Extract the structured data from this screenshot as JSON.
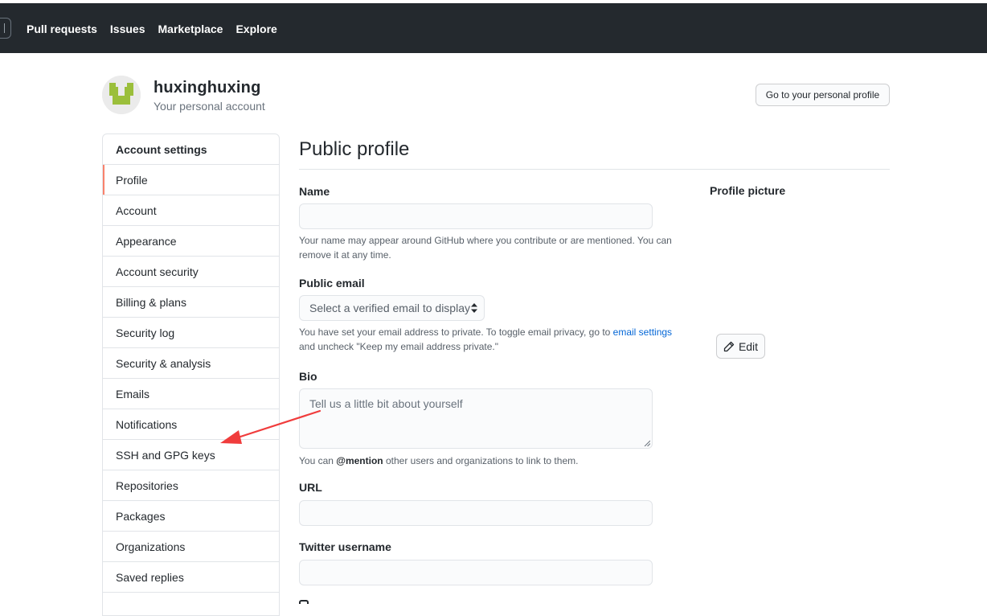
{
  "header": {
    "nav": [
      "Pull requests",
      "Issues",
      "Marketplace",
      "Explore"
    ]
  },
  "account": {
    "username": "huxinghuxing",
    "account_type": "Your personal account",
    "profile_button": "Go to your personal profile"
  },
  "sidebar": {
    "heading": "Account settings",
    "items": [
      {
        "label": "Profile",
        "active": true
      },
      {
        "label": "Account"
      },
      {
        "label": "Appearance"
      },
      {
        "label": "Account security"
      },
      {
        "label": "Billing & plans"
      },
      {
        "label": "Security log"
      },
      {
        "label": "Security & analysis"
      },
      {
        "label": "Emails"
      },
      {
        "label": "Notifications"
      },
      {
        "label": "SSH and GPG keys"
      },
      {
        "label": "Repositories"
      },
      {
        "label": "Packages"
      },
      {
        "label": "Organizations"
      },
      {
        "label": "Saved replies"
      }
    ]
  },
  "main": {
    "title": "Public profile",
    "name": {
      "label": "Name",
      "value": "",
      "note": "Your name may appear around GitHub where you contribute or are mentioned. You can remove it at any time."
    },
    "public_email": {
      "label": "Public email",
      "selected": "Select a verified email to display",
      "note_before": "You have set your email address to private. To toggle email privacy, go to ",
      "note_link": "email settings",
      "note_after": " and uncheck \"Keep my email address private.\""
    },
    "bio": {
      "label": "Bio",
      "placeholder": "Tell us a little bit about yourself",
      "note_before": "You can ",
      "note_mention": "@mention",
      "note_after": " other users and organizations to link to them."
    },
    "url": {
      "label": "URL",
      "value": ""
    },
    "twitter": {
      "label": "Twitter username",
      "value": ""
    }
  },
  "profile_picture": {
    "label": "Profile picture",
    "edit_button": "Edit"
  },
  "colors": {
    "header_bg": "#24292e",
    "active_accent": "#f9826c",
    "link": "#0366d6",
    "annotation_arrow": "#f03c3c"
  }
}
